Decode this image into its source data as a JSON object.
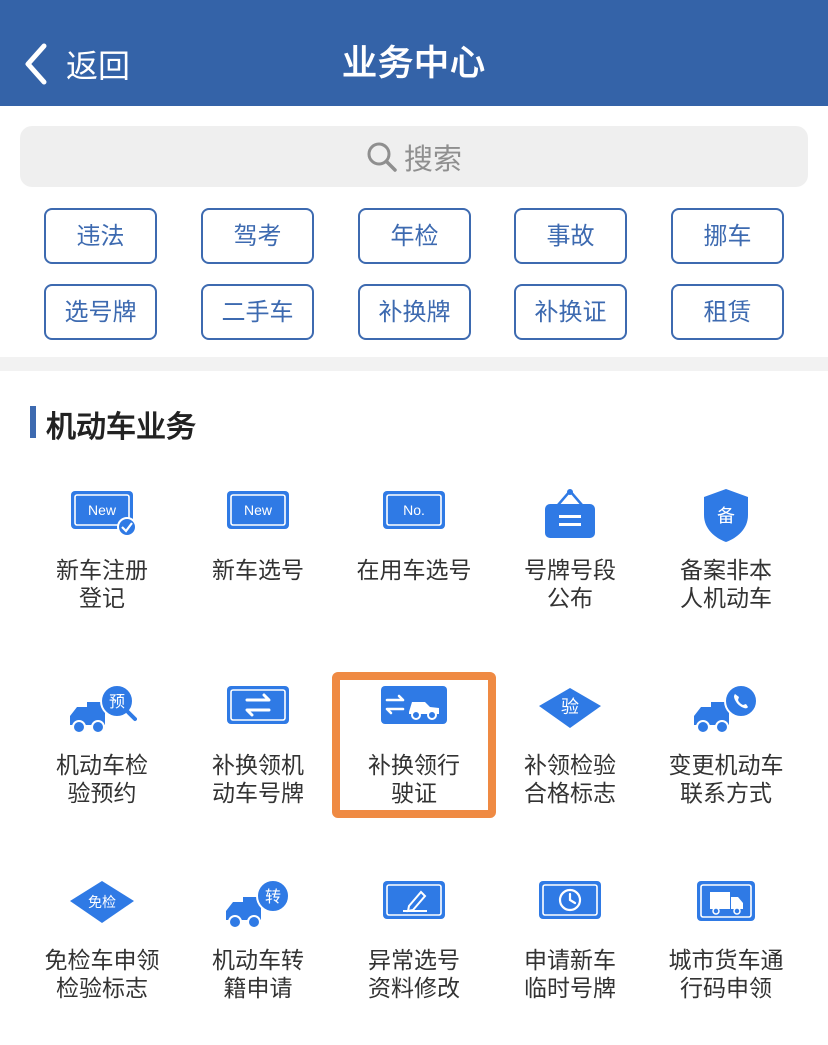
{
  "header": {
    "back_label": "返回",
    "title": "业务中心"
  },
  "search": {
    "placeholder": "搜索"
  },
  "chips": [
    "违法",
    "驾考",
    "年检",
    "事故",
    "挪车",
    "选号牌",
    "二手车",
    "补换牌",
    "补换证",
    "租赁"
  ],
  "section": {
    "title": "机动车业务"
  },
  "services": [
    {
      "label": "新车注册\n登记",
      "icon": "new-plate-check-icon",
      "badge": "New"
    },
    {
      "label": "新车选号",
      "icon": "new-plate-icon",
      "badge": "New"
    },
    {
      "label": "在用车选号",
      "icon": "number-plate-icon",
      "badge": "No."
    },
    {
      "label": "号牌号段\n公布",
      "icon": "hanging-sign-icon",
      "badge": ""
    },
    {
      "label": "备案非本\n人机动车",
      "icon": "shield-record-icon",
      "badge": "备"
    },
    {
      "label": "机动车检\n验预约",
      "icon": "truck-appointment-icon",
      "badge": "预"
    },
    {
      "label": "补换领机\n动车号牌",
      "icon": "plate-exchange-icon",
      "badge": ""
    },
    {
      "label": "补换领行\n驶证",
      "icon": "car-license-exchange-icon",
      "badge": ""
    },
    {
      "label": "补领检验\n合格标志",
      "icon": "inspection-diamond-icon",
      "badge": "验"
    },
    {
      "label": "变更机动车\n联系方式",
      "icon": "truck-phone-icon",
      "badge": ""
    },
    {
      "label": "免检车申领\n检验标志",
      "icon": "exempt-diamond-icon",
      "badge": "免检"
    },
    {
      "label": "机动车转\n籍申请",
      "icon": "truck-transfer-icon",
      "badge": "转"
    },
    {
      "label": "异常选号\n资料修改",
      "icon": "plate-edit-icon",
      "badge": ""
    },
    {
      "label": "申请新车\n临时号牌",
      "icon": "temporary-plate-clock-icon",
      "badge": ""
    },
    {
      "label": "城市货车通\n行码申领",
      "icon": "freight-truck-icon",
      "badge": ""
    }
  ],
  "highlighted_item": "补换领行驶证",
  "colors": {
    "header": "#3463a8",
    "accent": "#3d6ab0",
    "icon_blue": "#2f7ae5",
    "highlight": "#ef8a43"
  }
}
